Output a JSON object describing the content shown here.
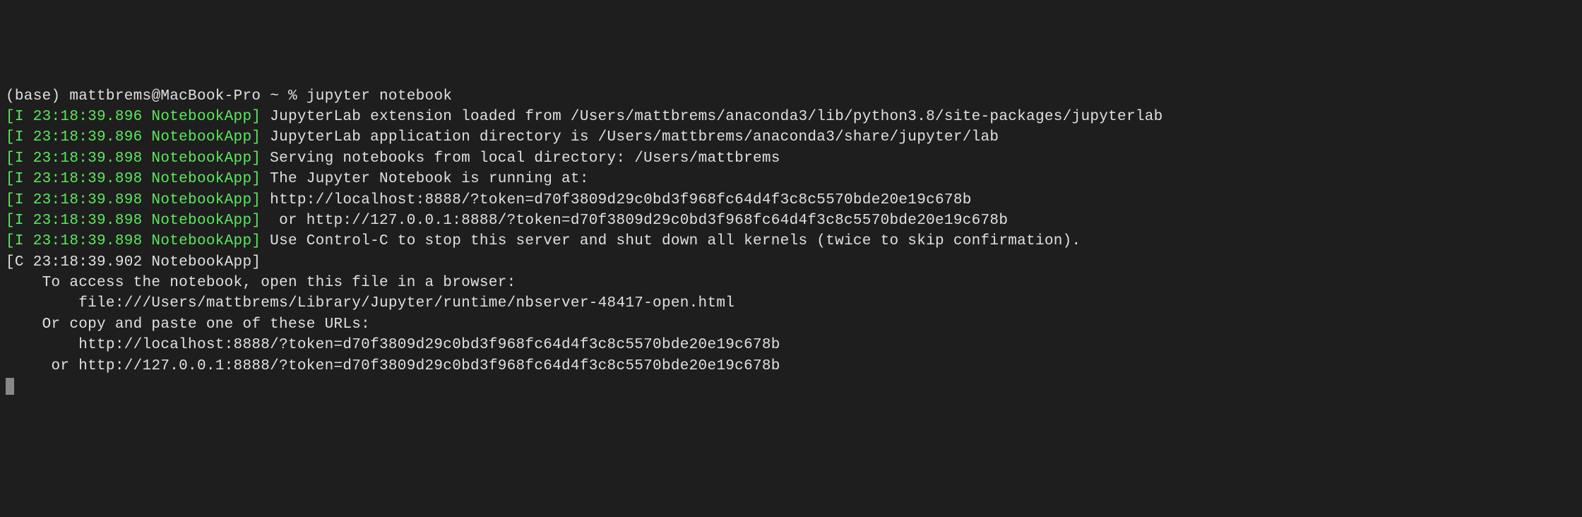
{
  "prompt": {
    "env": "(base)",
    "user_host": "mattbrems@MacBook-Pro",
    "path": "~",
    "symbol": "%",
    "command": "jupyter notebook"
  },
  "logs": [
    {
      "tag": "[I 23:18:39.896 NotebookApp]",
      "tag_class": "info-tag",
      "text": " JupyterLab extension loaded from /Users/mattbrems/anaconda3/lib/python3.8/site-packages/jupyterlab"
    },
    {
      "tag": "[I 23:18:39.896 NotebookApp]",
      "tag_class": "info-tag",
      "text": " JupyterLab application directory is /Users/mattbrems/anaconda3/share/jupyter/lab"
    },
    {
      "tag": "[I 23:18:39.898 NotebookApp]",
      "tag_class": "info-tag",
      "text": " Serving notebooks from local directory: /Users/mattbrems"
    },
    {
      "tag": "[I 23:18:39.898 NotebookApp]",
      "tag_class": "info-tag",
      "text": " The Jupyter Notebook is running at:"
    },
    {
      "tag": "[I 23:18:39.898 NotebookApp]",
      "tag_class": "info-tag",
      "text": " http://localhost:8888/?token=d70f3809d29c0bd3f968fc64d4f3c8c5570bde20e19c678b"
    },
    {
      "tag": "[I 23:18:39.898 NotebookApp]",
      "tag_class": "info-tag",
      "text": "  or http://127.0.0.1:8888/?token=d70f3809d29c0bd3f968fc64d4f3c8c5570bde20e19c678b"
    },
    {
      "tag": "[I 23:18:39.898 NotebookApp]",
      "tag_class": "info-tag",
      "text": " Use Control-C to stop this server and shut down all kernels (twice to skip confirmation)."
    },
    {
      "tag": "[C 23:18:39.902 NotebookApp]",
      "tag_class": "critical-tag",
      "text": ""
    }
  ],
  "access_info": {
    "blank": "",
    "header": "    To access the notebook, open this file in a browser:",
    "file_url": "        file:///Users/mattbrems/Library/Jupyter/runtime/nbserver-48417-open.html",
    "or_header": "    Or copy and paste one of these URLs:",
    "url1": "        http://localhost:8888/?token=d70f3809d29c0bd3f968fc64d4f3c8c5570bde20e19c678b",
    "url2": "     or http://127.0.0.1:8888/?token=d70f3809d29c0bd3f968fc64d4f3c8c5570bde20e19c678b"
  }
}
